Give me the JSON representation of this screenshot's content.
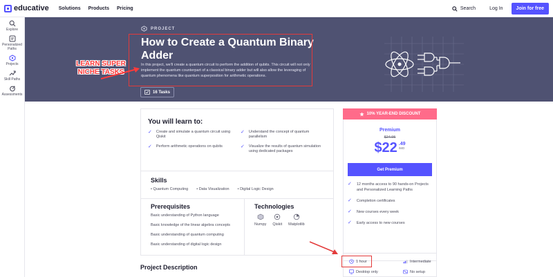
{
  "nav": {
    "logo": "educative",
    "links": [
      "Solutions",
      "Products",
      "Pricing"
    ],
    "search": "Search",
    "login": "Log In",
    "join": "Join for free"
  },
  "sidebar": {
    "items": [
      {
        "label": "Explore",
        "icon": "search-icon"
      },
      {
        "label": "Personalized Paths",
        "icon": "paths-icon"
      },
      {
        "label": "Projects",
        "icon": "projects-icon"
      },
      {
        "label": "Skill Paths",
        "icon": "trend-icon"
      },
      {
        "label": "Assessments",
        "icon": "assessment-icon"
      }
    ]
  },
  "hero": {
    "label": "PROJECT",
    "title": "How to Create a Quantum Binary Adder",
    "description": "In this project, we'll create a quantum circuit to perform the addition of qubits. This circuit will not only implement the quantum counterpart of a classical binary adder but will also allow the leveraging of quantum phenomena like quantum superposition for arithmetic operations.",
    "tasks": "16 Tasks",
    "annotation": "LEARN SUPER NICHE TASKS",
    "annotation_color": "#ff3b3b"
  },
  "learn": {
    "title": "You will learn to:",
    "items": [
      "Create and simulate a quantum circuit using Qiskit",
      "Understand the concept of quantum parallelism",
      "Perform arithmetic operations on qubits",
      "Visualize the results of quantum simulation using dedicated packages"
    ]
  },
  "skills": {
    "title": "Skills",
    "items": [
      "Quantum Computing",
      "Data Visualization",
      "Digital Logic Design"
    ]
  },
  "prereq": {
    "title": "Prerequisites",
    "items": [
      "Basic understanding of Python language",
      "Basic knowledge of the linear algebra concepts",
      "Basic understanding of quantum computing",
      "Basic understanding of digital logic design"
    ]
  },
  "tech": {
    "title": "Technologies",
    "items": [
      "Numpy",
      "Qiskit",
      "Matplotlib"
    ]
  },
  "description_title": "Project Description",
  "pricing": {
    "discount": "10% YEAR-END DISCOUNT",
    "plan": "Premium",
    "old_price": "$24.95",
    "price": "$22",
    "cents": ".49",
    "per": "/MO",
    "cta": "Get Premium",
    "features": [
      "12 months access to 90 hands-on Projects and Personalized Learning Paths",
      "Completion certificates",
      "New courses every week",
      "Early access to new courses"
    ],
    "accent": "#5553ff",
    "discount_color": "#ff6b8a"
  },
  "meta": {
    "duration": "1 hour",
    "level": "Intermediate",
    "platform": "Desktop only",
    "setup": "No setup"
  }
}
